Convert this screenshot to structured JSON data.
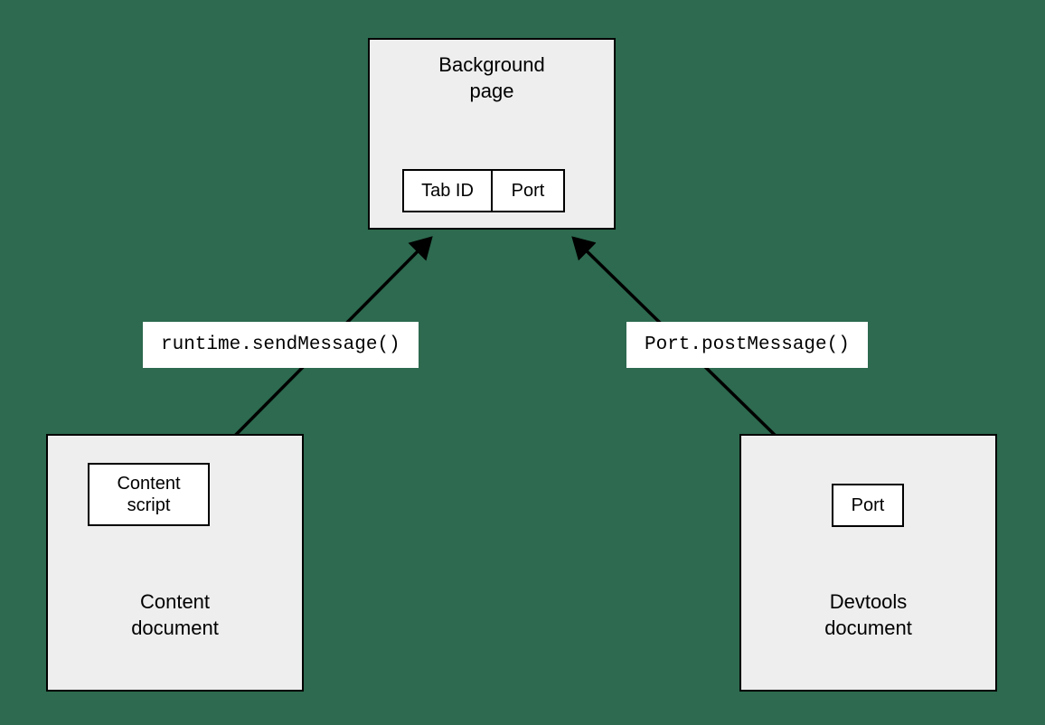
{
  "nodes": {
    "background": {
      "title": "Background\npage",
      "cells": {
        "tab_id": "Tab ID",
        "port": "Port"
      }
    },
    "content": {
      "title": "Content\ndocument",
      "cells": {
        "content_script": "Content\nscript"
      }
    },
    "devtools": {
      "title": "Devtools\ndocument",
      "cells": {
        "port": "Port"
      }
    }
  },
  "edges": {
    "left": {
      "label": "runtime.sendMessage()"
    },
    "right": {
      "label": "Port.postMessage()"
    }
  }
}
